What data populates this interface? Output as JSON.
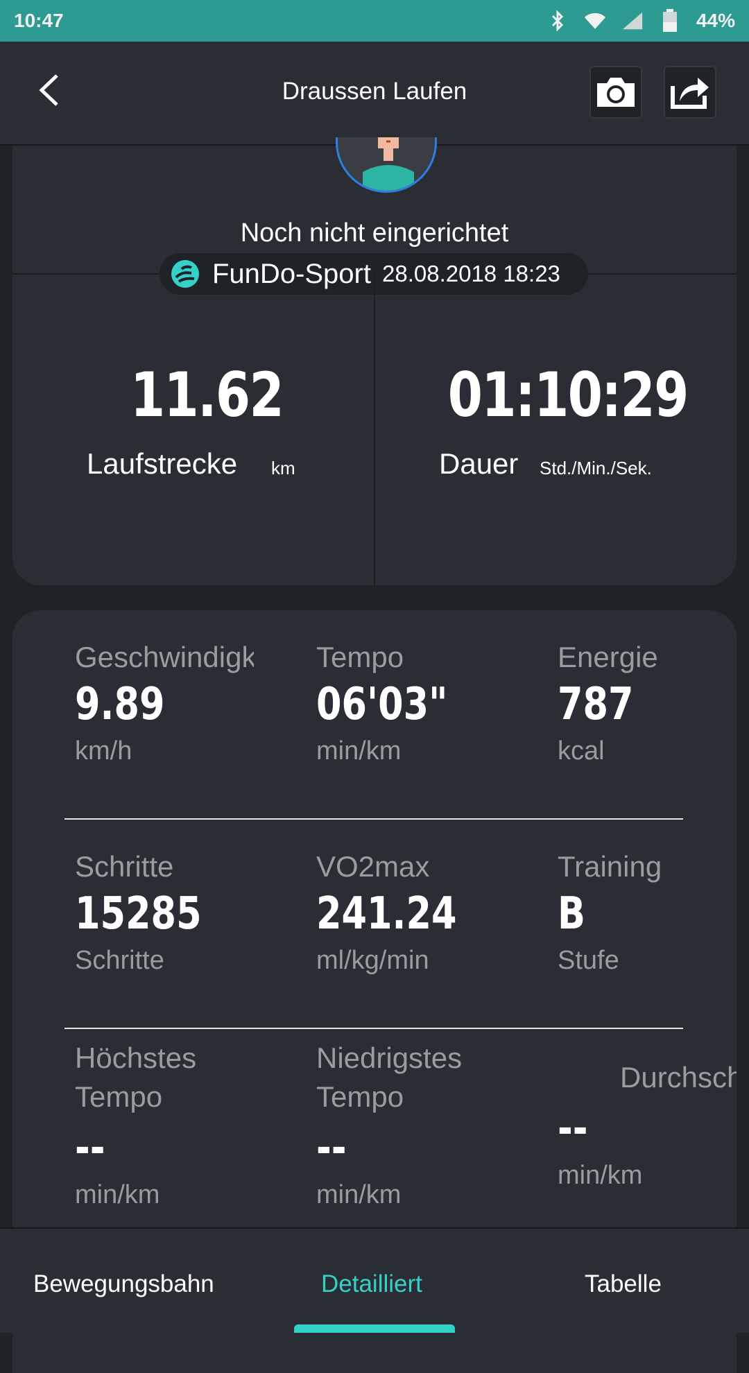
{
  "status_bar": {
    "time": "10:47",
    "battery": "44%"
  },
  "header": {
    "title": "Draussen Laufen"
  },
  "profile": {
    "name": "Noch nicht eingerichtet"
  },
  "source": {
    "app": "FunDo-Sport",
    "datetime": "28.08.2018 18:23"
  },
  "summary": {
    "distance": {
      "value": "11.62",
      "label": "Laufstrecke",
      "unit": "km"
    },
    "duration": {
      "value": "01:10:29",
      "label": "Dauer",
      "unit": "Std./Min./Sek."
    }
  },
  "metrics": [
    {
      "label": "Geschwindigkeit",
      "value": "9.89",
      "unit": "km/h"
    },
    {
      "label": "Tempo",
      "value": "06'03\"",
      "unit": "min/km"
    },
    {
      "label": "Energie",
      "value": "787",
      "unit": "kcal"
    },
    {
      "label": "Schritte",
      "value": "15285",
      "unit": "Schritte"
    },
    {
      "label": "VO2max",
      "value": "241.24",
      "unit": "ml/kg/min"
    },
    {
      "label": "Training",
      "value": "B",
      "unit": "Stufe"
    },
    {
      "label_line1": "Höchstes",
      "label_line2": "Tempo",
      "value": "--",
      "unit": "min/km"
    },
    {
      "label_line1": "Niedrigstes",
      "label_line2": "Tempo",
      "value": "--",
      "unit": "min/km"
    },
    {
      "label": "Durchschnitt",
      "value": "--",
      "unit": "min/km"
    }
  ],
  "tabs": [
    {
      "label": "Bewegungsbahn"
    },
    {
      "label": "Detailliert"
    },
    {
      "label": "Tabelle"
    }
  ],
  "colors": {
    "accent": "#35d0c8",
    "status_bar": "#2e9b93",
    "avatar_ring": "#2f7fe0"
  }
}
